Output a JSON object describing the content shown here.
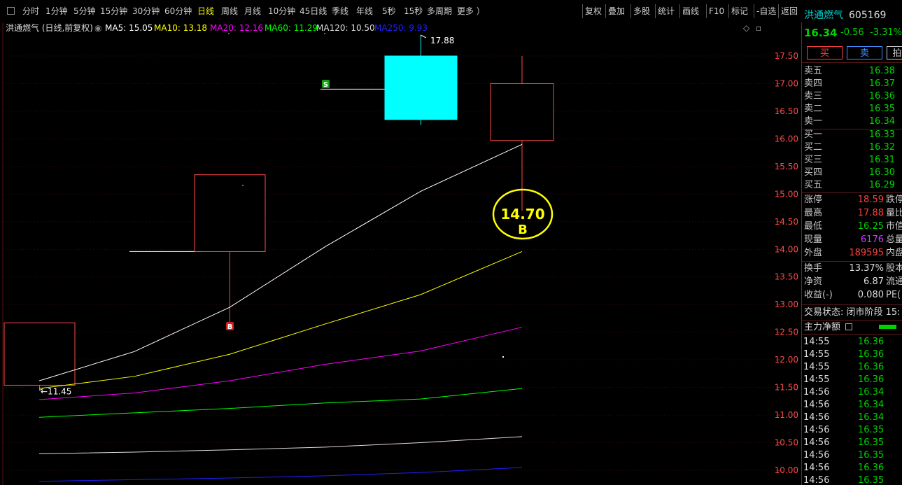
{
  "toolbar": {
    "periods": [
      "分时",
      "1分钟",
      "5分钟",
      "15分钟",
      "30分钟",
      "60分钟",
      "日线",
      "周线",
      "月线",
      "10分钟",
      "45日线",
      "季线",
      "年线",
      "5秒",
      "15秒",
      "多周期",
      "更多 ）"
    ],
    "active_period": "日线",
    "right_buttons": [
      "复权",
      "叠加",
      "多股",
      "统计",
      "画线",
      "F10",
      "标记",
      "-自选",
      "返回"
    ]
  },
  "chart": {
    "title": "洪通燃气 (日线,前复权)",
    "ma": [
      {
        "label": "MA5: 15.05",
        "color": "#ffffff"
      },
      {
        "label": "MA10: 13.18",
        "color": "#ffff00"
      },
      {
        "label": "MA20: 12.16",
        "color": "#ff00ff"
      },
      {
        "label": "MA60: 11.29",
        "color": "#00ff00"
      },
      {
        "label": "MA120: 10.50",
        "color": "#dcdcdc"
      },
      {
        "label": "MA250: 9.93",
        "color": "#2020ff"
      }
    ],
    "high_label": "17.88",
    "low_label": "11.45",
    "signal_label": "14.70",
    "signal_letter": "B",
    "marker_s": "S",
    "marker_b": "B"
  },
  "chart_data": {
    "type": "candlestick",
    "y_ticks": [
      17.5,
      17.0,
      16.5,
      16.0,
      15.5,
      15.0,
      14.5,
      14.0,
      13.5,
      13.0,
      12.5,
      12.0,
      11.5,
      11.0,
      10.5,
      10.0
    ],
    "y_tick_labels": [
      "17.50",
      "17.00",
      "16.50",
      "16.00",
      "15.50",
      "15.00",
      "14.50",
      "14.00",
      "13.50",
      "13.00",
      "12.50",
      "12.00",
      "11.50",
      "11.00",
      "10.50",
      "10.00"
    ],
    "ylim": [
      9.8,
      17.9
    ],
    "candles": [
      {
        "open": 11.54,
        "close": 12.67,
        "high": 12.67,
        "low": 11.45,
        "color": "red"
      },
      {
        "open": 13.96,
        "close": 13.96,
        "high": 13.96,
        "low": 13.96,
        "color": "white"
      },
      {
        "open": 13.96,
        "close": 15.35,
        "high": 15.35,
        "low": 12.68,
        "color": "red"
      },
      {
        "open": 16.9,
        "close": 16.9,
        "high": 16.9,
        "low": 16.9,
        "color": "white"
      },
      {
        "open": 17.5,
        "close": 16.35,
        "high": 17.88,
        "low": 16.25,
        "color": "cyan"
      },
      {
        "open": 15.97,
        "close": 17.0,
        "high": 17.5,
        "low": 14.7,
        "color": "red"
      }
    ],
    "ma_series": [
      {
        "name": "MA5",
        "color": "#ffffff",
        "values": [
          11.62,
          12.15,
          12.95,
          14.05,
          15.05,
          15.9
        ]
      },
      {
        "name": "MA10",
        "color": "#ffff00",
        "values": [
          11.48,
          11.7,
          12.1,
          12.65,
          13.18,
          13.96
        ]
      },
      {
        "name": "MA20",
        "color": "#ff00ff",
        "values": [
          11.28,
          11.4,
          11.62,
          11.92,
          12.16,
          12.59
        ]
      },
      {
        "name": "MA60",
        "color": "#00ff00",
        "values": [
          10.96,
          11.04,
          11.12,
          11.22,
          11.29,
          11.48
        ]
      },
      {
        "name": "MA120",
        "color": "#dcdcdc",
        "values": [
          10.3,
          10.33,
          10.37,
          10.42,
          10.5,
          10.61
        ]
      },
      {
        "name": "MA250",
        "color": "#2020ff",
        "values": [
          9.8,
          9.83,
          9.86,
          9.9,
          9.96,
          10.05
        ]
      }
    ]
  },
  "panel": {
    "stock_name": "洪通燃气",
    "stock_code": "605169",
    "price": "16.34",
    "change": "-0.56",
    "change_pct": "-3.31%",
    "buy_label": "买",
    "sell_label": "卖",
    "more_label": "拍",
    "asks": [
      {
        "label": "卖五",
        "price": "16.38"
      },
      {
        "label": "卖四",
        "price": "16.37"
      },
      {
        "label": "卖三",
        "price": "16.36"
      },
      {
        "label": "卖二",
        "price": "16.35"
      },
      {
        "label": "卖一",
        "price": "16.34"
      }
    ],
    "bids": [
      {
        "label": "买一",
        "price": "16.33"
      },
      {
        "label": "买二",
        "price": "16.32"
      },
      {
        "label": "买三",
        "price": "16.31"
      },
      {
        "label": "买四",
        "price": "16.30"
      },
      {
        "label": "买五",
        "price": "16.29"
      }
    ],
    "stats1": [
      {
        "label": "涨停",
        "value": "18.59",
        "value_color": "red",
        "tail": "跌停"
      },
      {
        "label": "最高",
        "value": "17.88",
        "value_color": "red",
        "tail": "量比"
      },
      {
        "label": "最低",
        "value": "16.25",
        "value_color": "green",
        "tail": "市值"
      },
      {
        "label": "现量",
        "value": "6176",
        "value_color": "purple",
        "tail": "总量"
      },
      {
        "label": "外盘",
        "value": "189595",
        "value_color": "red",
        "tail": "内盘"
      }
    ],
    "stats2": [
      {
        "label": "换手",
        "value": "13.37%",
        "value_color": "white",
        "tail": "股本"
      },
      {
        "label": "净资",
        "value": "6.87",
        "value_color": "white",
        "tail": "流通"
      },
      {
        "label": "收益(-)",
        "value": "0.080",
        "value_color": "white",
        "tail": "PE("
      }
    ],
    "trade_status": "交易状态: 闭市阶段 15:",
    "net_flow_label": "主力净额",
    "ticks": [
      {
        "time": "14:55",
        "price": "16.36"
      },
      {
        "time": "14:55",
        "price": "16.36"
      },
      {
        "time": "14:55",
        "price": "16.36"
      },
      {
        "time": "14:55",
        "price": "16.36"
      },
      {
        "time": "14:56",
        "price": "16.34"
      },
      {
        "time": "14:56",
        "price": "16.34"
      },
      {
        "time": "14:56",
        "price": "16.34"
      },
      {
        "time": "14:56",
        "price": "16.35"
      },
      {
        "time": "14:56",
        "price": "16.35"
      },
      {
        "time": "14:56",
        "price": "16.35"
      },
      {
        "time": "14:56",
        "price": "16.36"
      },
      {
        "time": "14:56",
        "price": "16.35"
      }
    ]
  }
}
